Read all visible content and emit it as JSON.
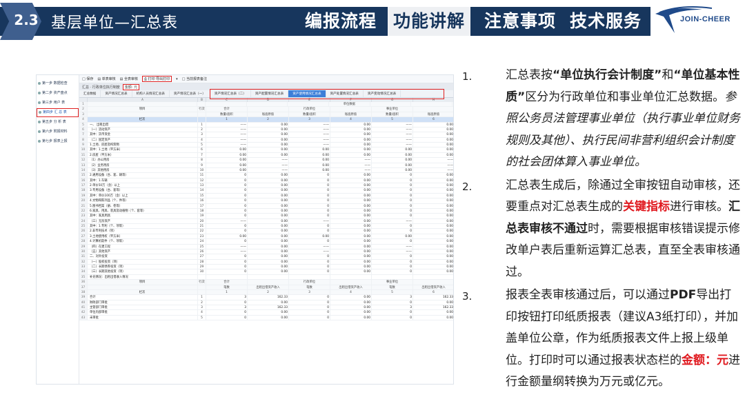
{
  "header": {
    "section_num": "2.3",
    "section_title": "基层单位—汇总表",
    "tabs": [
      {
        "label": "编报流程",
        "active": false
      },
      {
        "label": "功能讲解",
        "active": true
      },
      {
        "label": "注意事项",
        "active": false
      },
      {
        "label": "技术服务",
        "active": false
      }
    ],
    "logo_text": "JOIN-CHEER",
    "colors": {
      "navy": "#17365d",
      "accent_red": "#e0191f"
    }
  },
  "screenshot": {
    "steps": [
      {
        "label": "第一步 数据检查",
        "active": false
      },
      {
        "label": "第二步 资产盘点",
        "active": false
      },
      {
        "label": "第三步 用户 表",
        "active": false
      },
      {
        "label": "第四步 汇 总 表",
        "active": true
      },
      {
        "label": "第五步 分 析 表",
        "active": false
      },
      {
        "label": "第六步 附报材料",
        "active": false
      },
      {
        "label": "第七步 报表上报",
        "active": false
      }
    ],
    "toolbar": [
      {
        "label": "□ 保存",
        "hl": false
      },
      {
        "label": "▤ 单表审核",
        "hl": false
      },
      {
        "label": "▤ 全表审核",
        "hl": false
      },
      {
        "label": "⎙ 打印 导出打印",
        "hl": true
      },
      {
        "label": "▾",
        "hl": false
      },
      {
        "label": "□ 当前报表备注",
        "hl": false
      }
    ],
    "filter": {
      "label": "汇总 · 行政单位执行制度",
      "highlight": "金额: 元"
    },
    "tabs": [
      {
        "label": "汇总数据",
        "active": false
      },
      {
        "label": "资产情况汇总表",
        "active": false
      },
      {
        "label": "机构人员情况汇总表",
        "active": false
      },
      {
        "label": "资产情况汇总表（一）",
        "active": false
      },
      {
        "label": "资产情况汇总表（二）",
        "active": false
      },
      {
        "label": "资产配置情况汇总表",
        "active": false
      },
      {
        "label": "资产使用情况汇总表",
        "active": true
      },
      {
        "label": "资产处置情况汇总表",
        "active": false
      },
      {
        "label": "资产变动情况汇总表",
        "active": false
      }
    ],
    "columns": [
      "",
      "A",
      "B",
      "C",
      "D",
      "E",
      "F",
      "G",
      "H"
    ],
    "rows": [
      {
        "rn": "1",
        "label": "",
        "ln": "",
        "v": [
          "",
          "",
          "",
          "单位数据",
          "",
          "",
          ""
        ],
        "cls": "hdr"
      },
      {
        "rn": "2",
        "label": "项目",
        "ln": "行次",
        "v": [
          "合计",
          "",
          "行政单位",
          "",
          "事业单位",
          ""
        ],
        "cls": "hdr"
      },
      {
        "rn": "3",
        "label": "",
        "ln": "",
        "v": [
          "数量/面积",
          "账面原值",
          "数量/面积",
          "账面原值",
          "数量/面积",
          "账面原值"
        ],
        "cls": "hdr"
      },
      {
        "rn": "4",
        "label": "栏次",
        "ln": "",
        "v": [
          "1",
          "2",
          "3",
          "4",
          "5",
          "6"
        ],
        "cls": "sel"
      },
      {
        "rn": "5",
        "label": "一、 出租出借",
        "ln": "1",
        "v": [
          "——",
          "0.00",
          "——",
          "0.00",
          "——",
          "0.00"
        ]
      },
      {
        "rn": "6",
        "label": "（一）流动资产",
        "ln": "2",
        "v": [
          "——",
          "0.00",
          "——",
          "0.00",
          "——",
          "0.00"
        ]
      },
      {
        "rn": "7",
        "label": "其中：货币资金",
        "ln": "3",
        "v": [
          "——",
          "0.00",
          "——",
          "0.00",
          "——",
          "0.00"
        ]
      },
      {
        "rn": "8",
        "label": "（二）固定资产",
        "ln": "4",
        "v": [
          "——",
          "0.00",
          "——",
          "0.00",
          "——",
          "0.00"
        ]
      },
      {
        "rn": "9",
        "label": "1.土地、房屋及构筑物",
        "ln": "5",
        "v": [
          "——",
          "0.00",
          "——",
          "0.00",
          "——",
          "0.00"
        ]
      },
      {
        "rn": "10",
        "label": "其中：1.土地（平方米）",
        "ln": "6",
        "v": [
          "0.00",
          "0.00",
          "0.00",
          "0.00",
          "0.00",
          "0.00"
        ]
      },
      {
        "rn": "11",
        "label": "2.房屋（平方米）",
        "ln": "7",
        "v": [
          "0.00",
          "0.00",
          "0.00",
          "0.00",
          "0.00",
          "0.00"
        ]
      },
      {
        "rn": "12",
        "label": "（1）办公用房",
        "ln": "8",
        "v": [
          "0.00",
          "——",
          "0.00",
          "——",
          "0.00",
          "——"
        ]
      },
      {
        "rn": "13",
        "label": "（2）业务用房",
        "ln": "9",
        "v": [
          "0.00",
          "——",
          "0.00",
          "——",
          "0.00",
          "——"
        ]
      },
      {
        "rn": "14",
        "label": "（3）其他用房",
        "ln": "10",
        "v": [
          "0.00",
          "——",
          "0.00",
          "——",
          "0.00",
          "——"
        ]
      },
      {
        "rn": "15",
        "label": "2.通用设备（台、套、辆等）",
        "ln": "11",
        "v": [
          "0",
          "0.00",
          "0",
          "0.00",
          "0",
          "0.00"
        ]
      },
      {
        "rn": "16",
        "label": "其中：1.车辆",
        "ln": "12",
        "v": [
          "0",
          "0.00",
          "0",
          "0.00",
          "0",
          "0.00"
        ]
      },
      {
        "rn": "17",
        "label": "2.单价50万（含）以上",
        "ln": "13",
        "v": [
          "0",
          "0.00",
          "0",
          "0.00",
          "0",
          "0.00"
        ]
      },
      {
        "rn": "18",
        "label": "3.专用设备（台、套等）",
        "ln": "14",
        "v": [
          "0",
          "0.00",
          "0",
          "0.00",
          "0",
          "0.00"
        ]
      },
      {
        "rn": "19",
        "label": "其中：单价100万（含）以上",
        "ln": "15",
        "v": [
          "0",
          "0.00",
          "0",
          "0.00",
          "0",
          "0.00"
        ]
      },
      {
        "rn": "20",
        "label": "4.文物和陈列品（个、件等）",
        "ln": "16",
        "v": [
          "0",
          "0.00",
          "0",
          "0.00",
          "0",
          "0.00"
        ]
      },
      {
        "rn": "21",
        "label": "5.图书档案（册、卷等）",
        "ln": "17",
        "v": [
          "0",
          "0.00",
          "0",
          "0.00",
          "0",
          "0.00"
        ]
      },
      {
        "rn": "22",
        "label": "6.家具、用具、装具及动植物（个、套等）",
        "ln": "18",
        "v": [
          "0",
          "0.00",
          "0",
          "0.00",
          "0",
          "0.00"
        ]
      },
      {
        "rn": "23",
        "label": "其中：家具用具",
        "ln": "19",
        "v": [
          "0",
          "0.00",
          "0",
          "0.00",
          "0",
          "0.00"
        ]
      },
      {
        "rn": "24",
        "label": "（三）无形资产",
        "ln": "20",
        "v": [
          "——",
          "0.00",
          "——",
          "0.00",
          "——",
          "0.00"
        ]
      },
      {
        "rn": "25",
        "label": "其中：1.专利（个、项等）",
        "ln": "21",
        "v": [
          "0",
          "0.00",
          "0",
          "0.00",
          "0",
          "0.00"
        ]
      },
      {
        "rn": "26",
        "label": "2.非专利技术（项）",
        "ln": "22",
        "v": [
          "0",
          "0.00",
          "0",
          "0.00",
          "0",
          "0.00"
        ]
      },
      {
        "rn": "27",
        "label": "3.土地使用权（平方米）",
        "ln": "23",
        "v": [
          "0.00",
          "0.00",
          "0.00",
          "0.00",
          "0.00",
          "0.00"
        ]
      },
      {
        "rn": "28",
        "label": "4.计算机软件（个、项等）",
        "ln": "24",
        "v": [
          "0",
          "0.00",
          "0",
          "0.00",
          "0",
          "0.00"
        ]
      },
      {
        "rn": "29",
        "label": "（四）在建工程",
        "ln": "25",
        "v": [
          "——",
          "0.00",
          "——",
          "0.00",
          "——",
          "0.00"
        ]
      },
      {
        "rn": "30",
        "label": "（五）其他资产",
        "ln": "26",
        "v": [
          "——",
          "0.00",
          "——",
          "0.00",
          "——",
          "0.00"
        ]
      },
      {
        "rn": "31",
        "label": "二、对外投资",
        "ln": "27",
        "v": [
          "0",
          "0.00",
          "0",
          "0.00",
          "0",
          "0.00"
        ]
      },
      {
        "rn": "32",
        "label": "（一）股权投资（项）",
        "ln": "28",
        "v": [
          "0",
          "0.00",
          "0",
          "0.00",
          "0",
          "0.00"
        ]
      },
      {
        "rn": "33",
        "label": "（二）长期债券投资（项）",
        "ln": "29",
        "v": [
          "0",
          "0.00",
          "0",
          "0.00",
          "0",
          "0.00"
        ]
      },
      {
        "rn": "34",
        "label": "（三）长期其他投资（项）",
        "ln": "30",
        "v": [
          "0",
          "0.00",
          "0",
          "0.00",
          "0",
          "0.00"
        ]
      },
      {
        "rn": "35",
        "label": "补充情况：出租出借收入情况",
        "ln": "",
        "v": [
          "",
          "",
          "",
          "",
          "",
          ""
        ]
      },
      {
        "rn": "36",
        "label": "项目",
        "ln": "行次",
        "v": [
          "合计",
          "",
          "行政单位",
          "",
          "事业单位",
          ""
        ],
        "cls": "hdr"
      },
      {
        "rn": "37",
        "label": "",
        "ln": "",
        "v": [
          "笔数",
          "出租出借资产收入",
          "笔数",
          "出租出借资产收入",
          "笔数",
          "出租出借资产收入"
        ],
        "cls": "hdr"
      },
      {
        "rn": "38",
        "label": "栏次",
        "ln": "",
        "v": [
          "1",
          "2",
          "3",
          "4",
          "5",
          "6"
        ],
        "cls": "hdr"
      },
      {
        "rn": "39",
        "label": "合计",
        "ln": "1",
        "v": [
          "3",
          "162.33",
          "0",
          "0.00",
          "3",
          "162.33"
        ]
      },
      {
        "rn": "40",
        "label": "财政部门审批",
        "ln": "2",
        "v": [
          "0",
          "0.00",
          "0",
          "0.00",
          "0",
          "0.00"
        ]
      },
      {
        "rn": "41",
        "label": "主管部门审批",
        "ln": "3",
        "v": [
          "3",
          "162.33",
          "0",
          "0.00",
          "3",
          "162.33"
        ]
      },
      {
        "rn": "42",
        "label": "单位内部审批",
        "ln": "4",
        "v": [
          "0",
          "0.00",
          "0",
          "0.00",
          "0",
          "0.00"
        ]
      },
      {
        "rn": "43",
        "label": "未审批",
        "ln": "5",
        "v": [
          "0",
          "0.00",
          "0",
          "0.00",
          "0",
          "0.00"
        ]
      }
    ]
  },
  "notes": [
    {
      "num": "1.",
      "html": "汇总表按<span class=\"b\">“单位执行会计制度”</span>和<span class=\"b\">“单位基本性质”</span>区分为行政单位和事业单位汇总数据。<span class=\"it\">参照公务员法管理事业单位（执行事业单位财务规则及其他）、执行民间非营利组织会计制度的社会团体算入事业单位。</span>"
    },
    {
      "num": "2.",
      "html": "汇总表生成后，除通过全审按钮自动审核，还要重点对汇总表生成的<span class=\"red\">关键指标</span>进行审核。<span class=\"b\">汇总表审核不通过</span>时，需要根据审核错误提示修改单户表后重新运算汇总表，直至全表审核通过。"
    },
    {
      "num": "3.",
      "html": "报表全表审核通过后，可以通过<span class=\"b\">PDF</span>导出打印按钮打印纸质报表（建议A3纸打印），并加盖单位公章，作为纸质报表文件上报上级单位。打印时可以通过报表状态栏的<span class=\"red\">金额：元</span>进行金额量纲转换为万元或亿元。"
    }
  ]
}
